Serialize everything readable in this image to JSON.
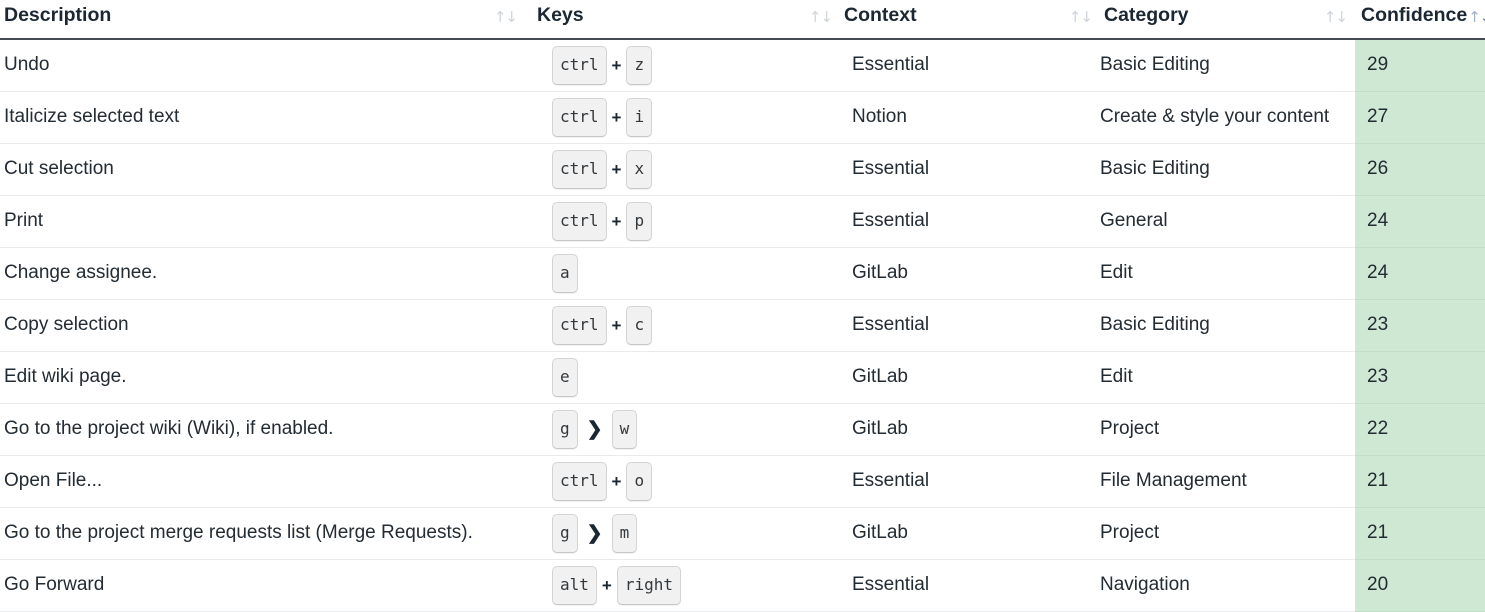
{
  "table": {
    "columns": [
      {
        "key": "description",
        "label": "Description",
        "sortable": true,
        "sort_state": "none"
      },
      {
        "key": "keys",
        "label": "Keys",
        "sortable": true,
        "sort_state": "none"
      },
      {
        "key": "context",
        "label": "Context",
        "sortable": true,
        "sort_state": "none"
      },
      {
        "key": "category",
        "label": "Category",
        "sortable": true,
        "sort_state": "none"
      },
      {
        "key": "confidence",
        "label": "Confidence",
        "sortable": true,
        "sort_state": "desc"
      }
    ],
    "sort_icon_glyph": {
      "up": "↑",
      "down": "↓"
    },
    "highlight_color": "#cfe8d4",
    "rows": [
      {
        "description": "Undo",
        "keys": [
          {
            "type": "key",
            "label": "ctrl"
          },
          {
            "type": "sep",
            "label": "+"
          },
          {
            "type": "key",
            "label": "z"
          }
        ],
        "context": "Essential",
        "category": "Basic Editing",
        "confidence": "29"
      },
      {
        "description": "Italicize selected text",
        "keys": [
          {
            "type": "key",
            "label": "ctrl"
          },
          {
            "type": "sep",
            "label": "+"
          },
          {
            "type": "key",
            "label": "i"
          }
        ],
        "context": "Notion",
        "category": "Create & style your content",
        "confidence": "27"
      },
      {
        "description": "Cut selection",
        "keys": [
          {
            "type": "key",
            "label": "ctrl"
          },
          {
            "type": "sep",
            "label": "+"
          },
          {
            "type": "key",
            "label": "x"
          }
        ],
        "context": "Essential",
        "category": "Basic Editing",
        "confidence": "26"
      },
      {
        "description": "Print",
        "keys": [
          {
            "type": "key",
            "label": "ctrl"
          },
          {
            "type": "sep",
            "label": "+"
          },
          {
            "type": "key",
            "label": "p"
          }
        ],
        "context": "Essential",
        "category": "General",
        "confidence": "24"
      },
      {
        "description": "Change assignee.",
        "keys": [
          {
            "type": "key",
            "label": "a"
          }
        ],
        "context": "GitLab",
        "category": "Edit",
        "confidence": "24"
      },
      {
        "description": "Copy selection",
        "keys": [
          {
            "type": "key",
            "label": "ctrl"
          },
          {
            "type": "sep",
            "label": "+"
          },
          {
            "type": "key",
            "label": "c"
          }
        ],
        "context": "Essential",
        "category": "Basic Editing",
        "confidence": "23"
      },
      {
        "description": "Edit wiki page.",
        "keys": [
          {
            "type": "key",
            "label": "e"
          }
        ],
        "context": "GitLab",
        "category": "Edit",
        "confidence": "23"
      },
      {
        "description": "Go to the project wiki (Wiki), if enabled.",
        "keys": [
          {
            "type": "key",
            "label": "g"
          },
          {
            "type": "chevron",
            "label": "❯"
          },
          {
            "type": "key",
            "label": "w"
          }
        ],
        "context": "GitLab",
        "category": "Project",
        "confidence": "22"
      },
      {
        "description": "Open File...",
        "keys": [
          {
            "type": "key",
            "label": "ctrl"
          },
          {
            "type": "sep",
            "label": "+"
          },
          {
            "type": "key",
            "label": "o"
          }
        ],
        "context": "Essential",
        "category": "File Management",
        "confidence": "21"
      },
      {
        "description": "Go to the project merge requests list (Merge Requests).",
        "keys": [
          {
            "type": "key",
            "label": "g"
          },
          {
            "type": "chevron",
            "label": "❯"
          },
          {
            "type": "key",
            "label": "m"
          }
        ],
        "context": "GitLab",
        "category": "Project",
        "confidence": "21"
      },
      {
        "description": "Go Forward",
        "keys": [
          {
            "type": "key",
            "label": "alt"
          },
          {
            "type": "sep",
            "label": "+"
          },
          {
            "type": "key",
            "label": "right"
          }
        ],
        "context": "Essential",
        "category": "Navigation",
        "confidence": "20"
      }
    ]
  }
}
